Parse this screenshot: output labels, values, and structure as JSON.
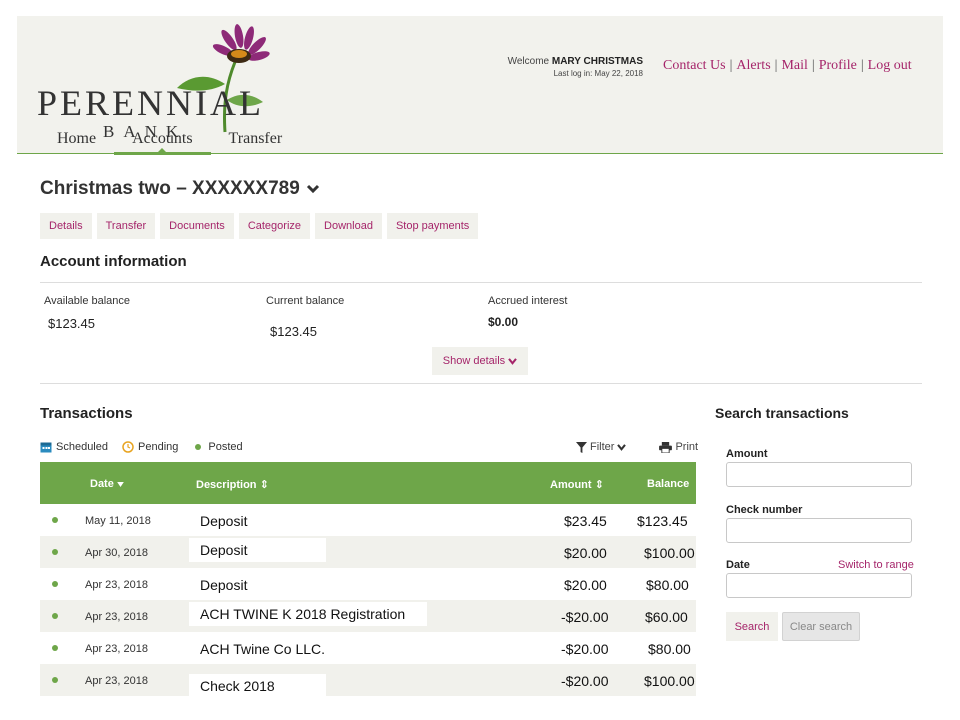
{
  "brand": {
    "logo_word": "PERENNIAL",
    "logo_sub": "BANK"
  },
  "user": {
    "welcome_prefix": "Welcome",
    "name": "MARY CHRISTMAS",
    "last_login": "Last log in: May 22, 2018"
  },
  "top_links": [
    "Contact Us",
    "Alerts",
    "Mail",
    "Profile",
    "Log out"
  ],
  "nav": [
    {
      "label": "Home",
      "active": false
    },
    {
      "label": "Accounts",
      "active": true
    },
    {
      "label": "Transfer",
      "active": false
    }
  ],
  "account": {
    "title": "Christmas two – XXXXXX789",
    "tabs": [
      "Details",
      "Transfer",
      "Documents",
      "Categorize",
      "Download",
      "Stop payments"
    ]
  },
  "account_info": {
    "heading": "Account information",
    "available_label": "Available balance",
    "available_value": "$123.45",
    "current_label": "Current balance",
    "current_value": "$123.45",
    "interest_label": "Accrued interest",
    "interest_value": "$0.00",
    "show_details": "Show details"
  },
  "transactions": {
    "heading": "Transactions",
    "legend": {
      "scheduled": "Scheduled",
      "pending": "Pending",
      "posted": "Posted"
    },
    "filter": "Filter",
    "print": "Print",
    "columns": {
      "date": "Date",
      "description": "Description",
      "amount": "Amount",
      "balance": "Balance"
    },
    "rows": [
      {
        "date": "May 11, 2018",
        "description": "Deposit",
        "amount": "$23.45",
        "balance": "$123.45"
      },
      {
        "date": "Apr 30, 2018",
        "description": "Deposit",
        "amount": "$20.00",
        "balance": "$100.00"
      },
      {
        "date": "Apr 23, 2018",
        "description": "Deposit",
        "amount": "$20.00",
        "balance": "$80.00"
      },
      {
        "date": "Apr 23, 2018",
        "description": "ACH TWINE K 2018 Registration",
        "amount": "-$20.00",
        "balance": "$60.00"
      },
      {
        "date": "Apr 23, 2018",
        "description": "ACH Twine Co LLC.",
        "amount": "-$20.00",
        "balance": "$80.00"
      },
      {
        "date": "Apr 23, 2018",
        "description": "Check 2018",
        "amount": "-$20.00",
        "balance": "$100.00"
      }
    ]
  },
  "search": {
    "heading": "Search transactions",
    "amount_label": "Amount",
    "check_label": "Check number",
    "date_label": "Date",
    "switch_range": "Switch to range",
    "search_button": "Search",
    "clear_button": "Clear search"
  },
  "colors": {
    "accent": "#a5256a",
    "green": "#6ea649",
    "panel": "#f1f1ec"
  }
}
